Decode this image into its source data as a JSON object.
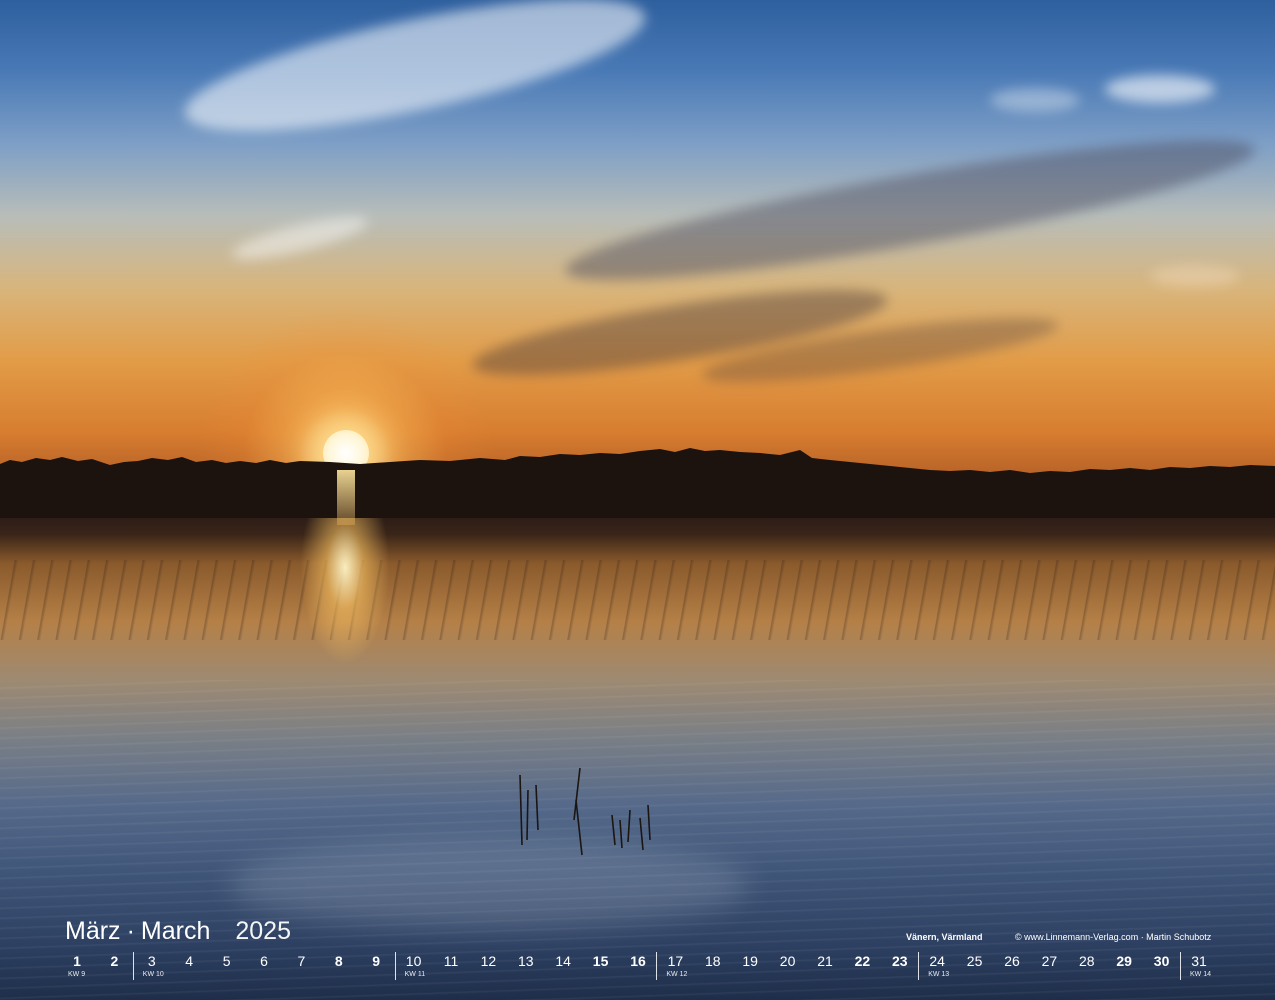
{
  "calendar": {
    "month_de": "März",
    "separator": "·",
    "month_en": "March",
    "year": "2025",
    "location": "Vänern, Värmland",
    "credit": "© www.Linnemann-Verlag.com · Martin Schubotz",
    "days": [
      "1",
      "2",
      "3",
      "4",
      "5",
      "6",
      "7",
      "8",
      "9",
      "10",
      "11",
      "12",
      "13",
      "14",
      "15",
      "16",
      "17",
      "18",
      "19",
      "20",
      "21",
      "22",
      "23",
      "24",
      "25",
      "26",
      "27",
      "28",
      "29",
      "30",
      "31"
    ],
    "weekend_days": [
      "1",
      "2",
      "8",
      "9",
      "15",
      "16",
      "22",
      "23",
      "29",
      "30"
    ],
    "week_labels": [
      "KW 9",
      "KW 10",
      "KW 11",
      "KW 12",
      "KW 13",
      "KW 14"
    ]
  },
  "colors": {
    "sky_top": "#2e5f9e",
    "horizon": "#d77d30",
    "sun": "#fff6d8",
    "water_bottom": "#1e2e4a",
    "text": "#ffffff"
  }
}
